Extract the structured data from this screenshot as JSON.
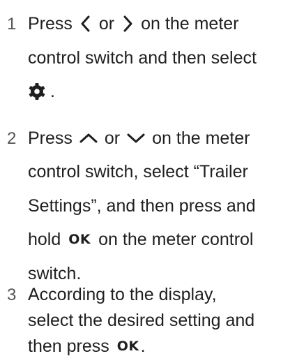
{
  "steps": [
    {
      "number": "1",
      "lines": [
        {
          "before": "Press",
          "mid": "or",
          "after": "on the meter"
        },
        "control switch and then select",
        "."
      ],
      "icons": [
        "chevron-left-icon",
        "chevron-right-icon",
        "gear-icon"
      ]
    },
    {
      "number": "2",
      "lines": [
        {
          "before": "Press",
          "mid": "or",
          "after": "on the meter"
        },
        "control switch, select “Trailer",
        "Settings”, and then press and",
        {
          "before": "hold",
          "ok": "OK",
          "after": "on the meter control"
        },
        "switch."
      ],
      "icons": [
        "chevron-up-icon",
        "chevron-down-icon"
      ]
    },
    {
      "number": "3",
      "lines": [
        "According to the display,",
        "select the desired setting and",
        {
          "before": "then press",
          "ok": "OK",
          "after": "."
        }
      ]
    }
  ]
}
